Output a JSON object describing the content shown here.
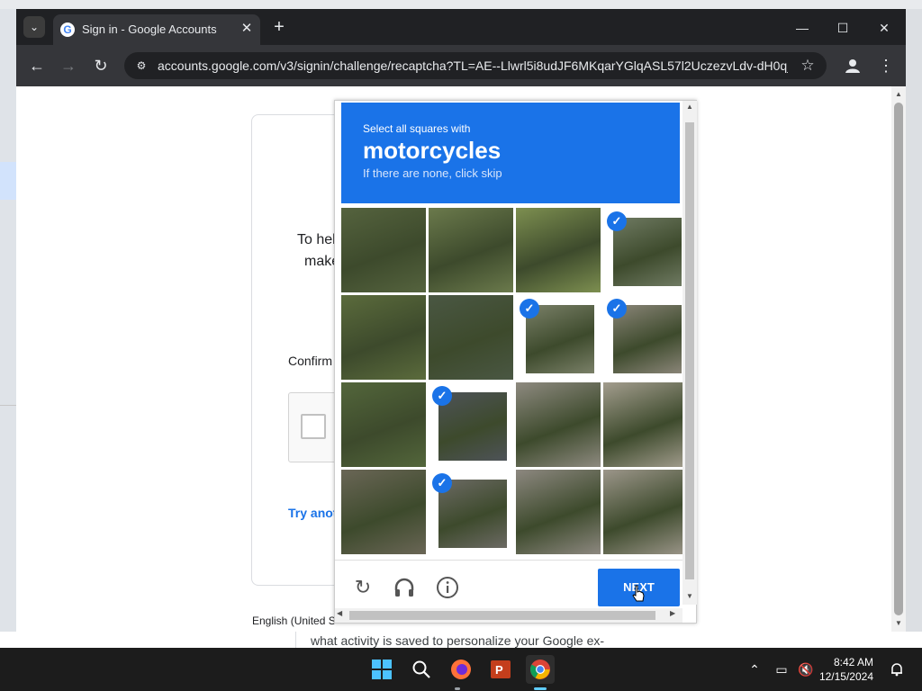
{
  "browser": {
    "tab_title": "Sign in - Google Accounts",
    "tab_favicon": "G",
    "tab_close": "✕",
    "new_tab": "+",
    "url": "accounts.google.com/v3/signin/challenge/recaptcha?TL=AE--Llwrl5i8udJF6MKqarYGlqASL57l2UczezvLdv-dH0q_...",
    "controls": {
      "minimize": "—",
      "maximize": "☐",
      "close": "✕"
    }
  },
  "signin": {
    "text_line1": "To hel",
    "text_line2": "make",
    "confirm_text": "Confirm",
    "try_another": "Try anot",
    "language": "English (United S"
  },
  "background": {
    "partial_text": "what activity is saved to personalize your Google ex-"
  },
  "captcha": {
    "instruction_small": "Select all squares with",
    "target": "motorcycles",
    "hint": "If there are none, click skip",
    "next_label": "NEXT",
    "tiles": [
      {
        "selected": false,
        "color": "#55633e"
      },
      {
        "selected": false,
        "color": "#6b7a4c"
      },
      {
        "selected": false,
        "color": "#7d8f50"
      },
      {
        "selected": true,
        "color": "#6f7a62"
      },
      {
        "selected": false,
        "color": "#5b6b3c"
      },
      {
        "selected": false,
        "color": "#4a5743"
      },
      {
        "selected": true,
        "color": "#7a8068"
      },
      {
        "selected": true,
        "color": "#8a8578"
      },
      {
        "selected": false,
        "color": "#53663b"
      },
      {
        "selected": true,
        "color": "#4e5358"
      },
      {
        "selected": false,
        "color": "#8e8a80"
      },
      {
        "selected": false,
        "color": "#a39d8e"
      },
      {
        "selected": false,
        "color": "#6a6656"
      },
      {
        "selected": true,
        "color": "#6c6a64"
      },
      {
        "selected": false,
        "color": "#8d8880"
      },
      {
        "selected": false,
        "color": "#9c968a"
      }
    ],
    "icons": [
      "reload-icon",
      "audio-icon",
      "info-icon"
    ]
  },
  "taskbar": {
    "apps": [
      "windows-start-icon",
      "search-icon",
      "firefox-icon",
      "powerpoint-icon",
      "chrome-icon"
    ],
    "time": "8:42 AM",
    "date": "12/15/2024"
  },
  "colors": {
    "captcha_blue": "#1a73e8",
    "link_blue": "#1a73e8"
  }
}
